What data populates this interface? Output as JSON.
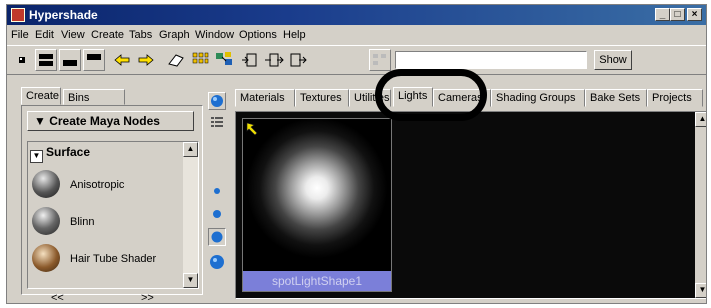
{
  "window": {
    "title": "Hypershade"
  },
  "menu": [
    "File",
    "Edit",
    "View",
    "Create",
    "Tabs",
    "Graph",
    "Window",
    "Options",
    "Help"
  ],
  "toolbar": {
    "show_label": "Show",
    "search_value": ""
  },
  "left_tabs": [
    "Create",
    "Bins"
  ],
  "create_menu": {
    "label": "Create Maya Nodes"
  },
  "list": {
    "header": "Surface",
    "items": [
      {
        "label": "Anisotropic",
        "icon": "anisotropic-sphere-icon"
      },
      {
        "label": "Blinn",
        "icon": "blinn-sphere-icon"
      },
      {
        "label": "Hair Tube Shader",
        "icon": "hair-tube-shader-icon"
      }
    ]
  },
  "h_scroll": {
    "left": "<<",
    "right": ">>"
  },
  "right_tabs": [
    "Materials",
    "Textures",
    "Utilities",
    "Lights",
    "Cameras",
    "Shading Groups",
    "Bake Sets",
    "Projects"
  ],
  "selected_tab": "Lights",
  "node": {
    "label": "spotLightShape1"
  },
  "colors": {
    "title_bar": "#0a246a",
    "selection": "#7b7fd9",
    "annotation": "#000000"
  }
}
